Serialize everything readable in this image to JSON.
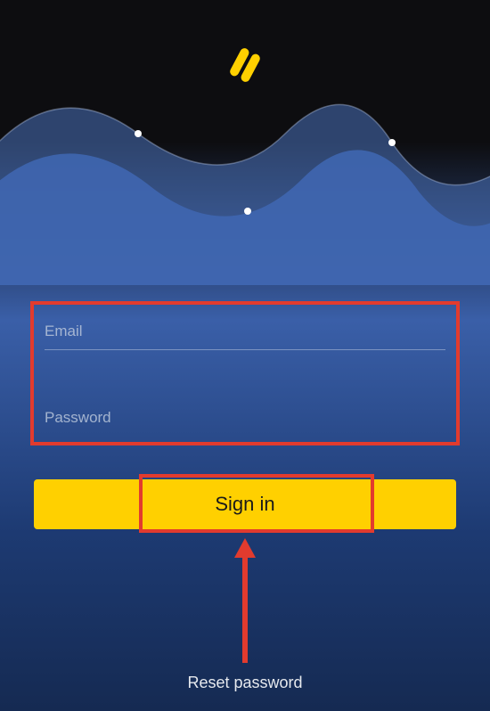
{
  "colors": {
    "accent": "#ffd000",
    "highlight": "#e23b2e",
    "background_top": "#0d0d10",
    "background_bottom": "#152a52"
  },
  "logo": {
    "name": "app-logo-icon"
  },
  "form": {
    "email": {
      "placeholder": "Email",
      "value": ""
    },
    "password": {
      "placeholder": "Password",
      "value": ""
    }
  },
  "actions": {
    "signin_label": "Sign in",
    "reset_password_label": "Reset password"
  },
  "annotations": {
    "form_highlight": true,
    "signin_highlight": true,
    "arrow_points_to": "reset-password-link"
  }
}
